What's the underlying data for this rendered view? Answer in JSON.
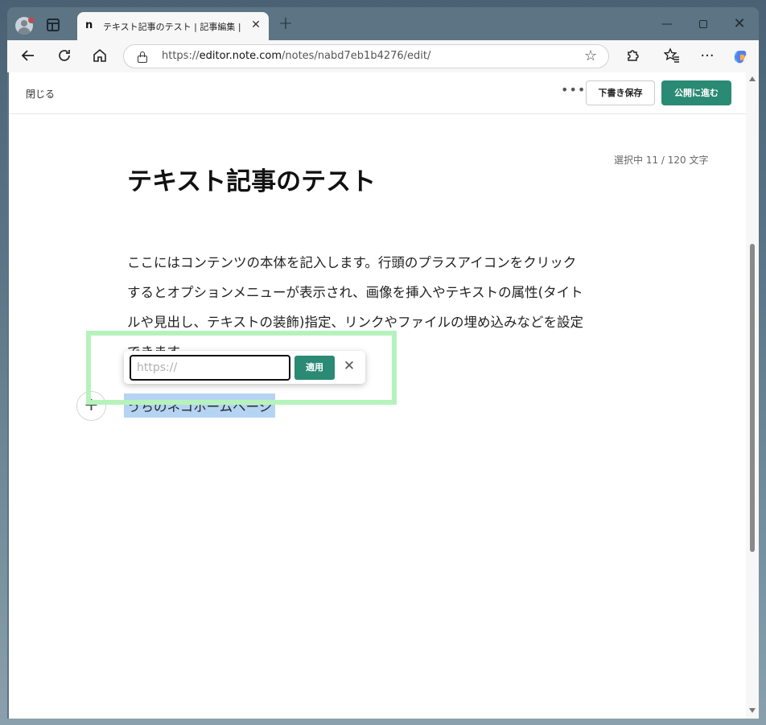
{
  "browser": {
    "tab_title": "テキスト記事のテスト | 記事編集 | note",
    "tab_favicon": "n",
    "new_tab": "+",
    "url_prefix": "https://",
    "url_host": "editor.note.com",
    "url_path": "/notes/nabd7eb1b4276/edit/",
    "icons": [
      "profile-icon",
      "tab-actions-icon",
      "back-icon",
      "refresh-icon",
      "home-icon",
      "lock-icon",
      "favorite-star-icon",
      "extensions-icon",
      "favorites-icon",
      "more-icon",
      "copilot-icon"
    ]
  },
  "editor": {
    "close_label": "閉じる",
    "more_label": "•••",
    "draft_label": "下書き保存",
    "publish_label": "公開に進む",
    "char_count": "選択中 11 / 120 文字",
    "title": "テキスト記事のテスト",
    "body_lines": [
      "ここにはコンテンツの本体を記入します。行頭のプラスアイコンをクリック",
      "するとオプションメニューが表示され、画像を挿入やテキストの属性(タイト",
      "ルや見出し、テキストの装飾)指定、リンクやファイルの埋め込みなどを設定",
      "できます。"
    ],
    "link_text": "うちのネコホームページ",
    "link_popup": {
      "placeholder": "https://",
      "apply_label": "適用",
      "close_label": "✕"
    },
    "add_label": "+"
  },
  "colors": {
    "accent": "#2a8a74",
    "selection": "#b5d4f3",
    "highlight": "#b6f3bc"
  }
}
